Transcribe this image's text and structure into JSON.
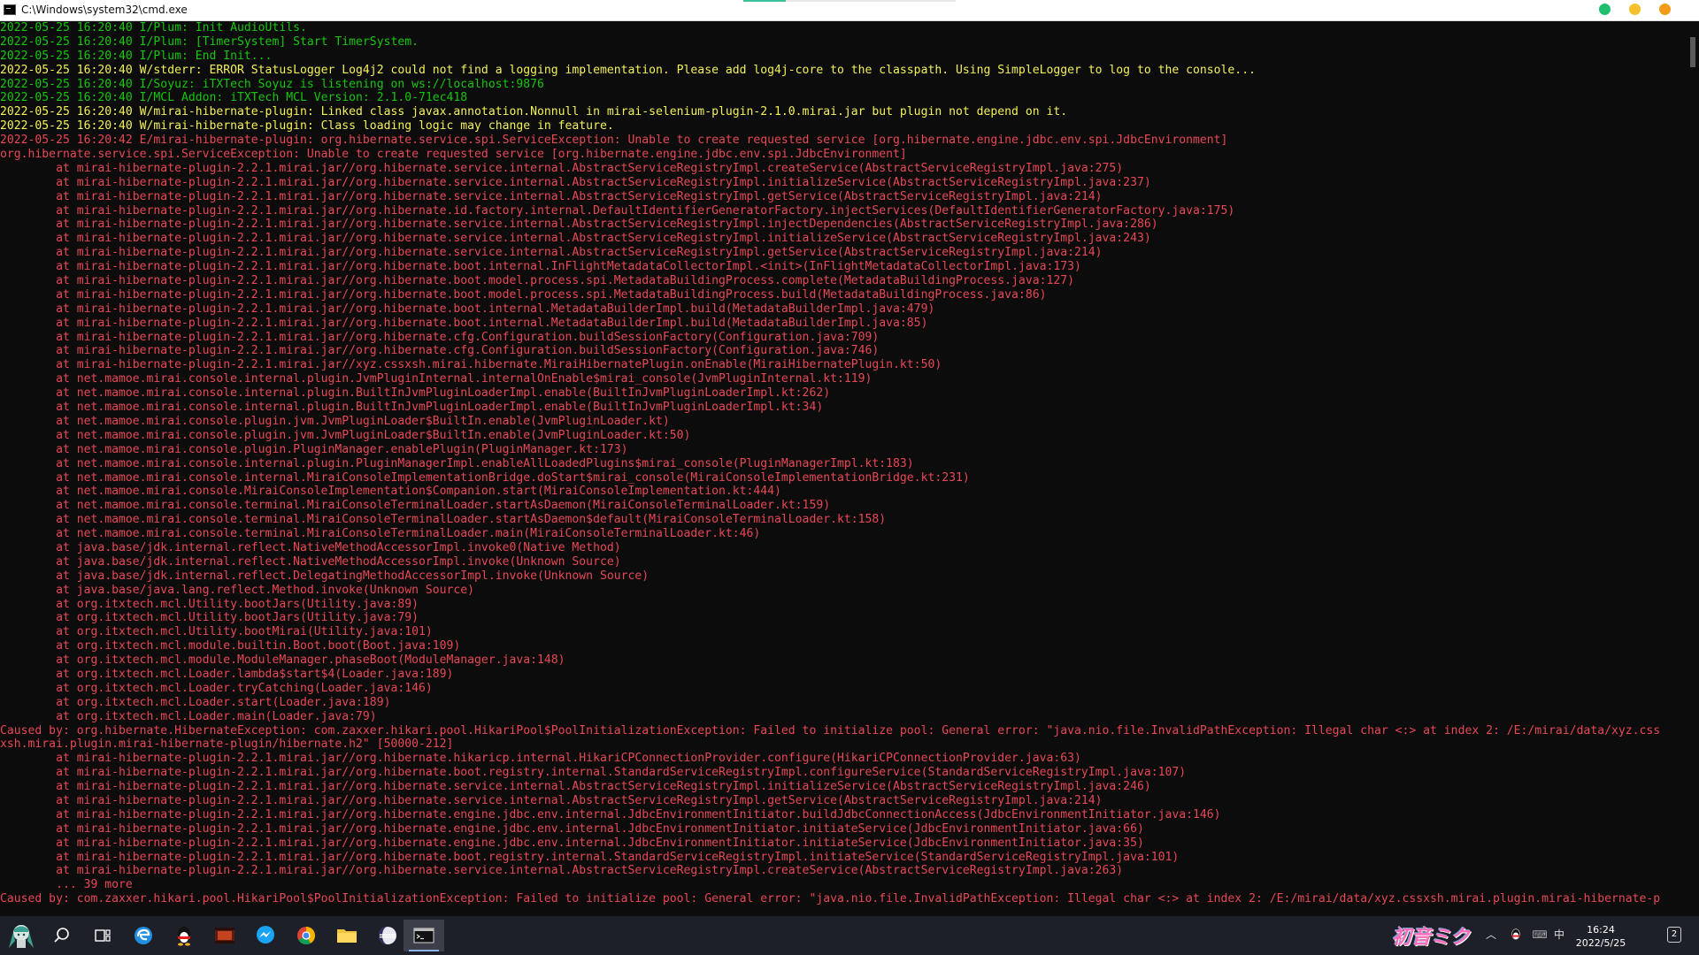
{
  "window": {
    "title": "C:\\Windows\\system32\\cmd.exe"
  },
  "colors": {
    "info": "#16c60c",
    "warn": "#f3f158",
    "error": "#e74856",
    "background": "#0c0c0c"
  },
  "console": {
    "lines": [
      {
        "c": "g",
        "t": "2022-05-25 16:20:40 I/Plum: Init AudioUtils."
      },
      {
        "c": "g",
        "t": "2022-05-25 16:20:40 I/Plum: [TimerSystem] Start TimerSystem."
      },
      {
        "c": "g",
        "t": "2022-05-25 16:20:40 I/Plum: End Init..."
      },
      {
        "c": "y",
        "t": "2022-05-25 16:20:40 W/stderr: ERROR StatusLogger Log4j2 could not find a logging implementation. Please add log4j-core to the classpath. Using SimpleLogger to log to the console..."
      },
      {
        "c": "g",
        "t": "2022-05-25 16:20:40 I/Soyuz: iTXTech Soyuz is listening on ws://localhost:9876"
      },
      {
        "c": "g",
        "t": "2022-05-25 16:20:40 I/MCL Addon: iTXTech MCL Version: 2.1.0-71ec418"
      },
      {
        "c": "y",
        "t": "2022-05-25 16:20:40 W/mirai-hibernate-plugin: Linked class javax.annotation.Nonnull in mirai-selenium-plugin-2.1.0.mirai.jar but plugin not depend on it."
      },
      {
        "c": "y",
        "t": "2022-05-25 16:20:40 W/mirai-hibernate-plugin: Class loading logic may change in feature."
      },
      {
        "c": "r",
        "t": "2022-05-25 16:20:42 E/mirai-hibernate-plugin: org.hibernate.service.spi.ServiceException: Unable to create requested service [org.hibernate.engine.jdbc.env.spi.JdbcEnvironment]"
      },
      {
        "c": "r",
        "t": "org.hibernate.service.spi.ServiceException: Unable to create requested service [org.hibernate.engine.jdbc.env.spi.JdbcEnvironment]"
      },
      {
        "c": "r",
        "t": "        at mirai-hibernate-plugin-2.2.1.mirai.jar//org.hibernate.service.internal.AbstractServiceRegistryImpl.createService(AbstractServiceRegistryImpl.java:275)"
      },
      {
        "c": "r",
        "t": "        at mirai-hibernate-plugin-2.2.1.mirai.jar//org.hibernate.service.internal.AbstractServiceRegistryImpl.initializeService(AbstractServiceRegistryImpl.java:237)"
      },
      {
        "c": "r",
        "t": "        at mirai-hibernate-plugin-2.2.1.mirai.jar//org.hibernate.service.internal.AbstractServiceRegistryImpl.getService(AbstractServiceRegistryImpl.java:214)"
      },
      {
        "c": "r",
        "t": "        at mirai-hibernate-plugin-2.2.1.mirai.jar//org.hibernate.id.factory.internal.DefaultIdentifierGeneratorFactory.injectServices(DefaultIdentifierGeneratorFactory.java:175)"
      },
      {
        "c": "r",
        "t": "        at mirai-hibernate-plugin-2.2.1.mirai.jar//org.hibernate.service.internal.AbstractServiceRegistryImpl.injectDependencies(AbstractServiceRegistryImpl.java:286)"
      },
      {
        "c": "r",
        "t": "        at mirai-hibernate-plugin-2.2.1.mirai.jar//org.hibernate.service.internal.AbstractServiceRegistryImpl.initializeService(AbstractServiceRegistryImpl.java:243)"
      },
      {
        "c": "r",
        "t": "        at mirai-hibernate-plugin-2.2.1.mirai.jar//org.hibernate.service.internal.AbstractServiceRegistryImpl.getService(AbstractServiceRegistryImpl.java:214)"
      },
      {
        "c": "r",
        "t": "        at mirai-hibernate-plugin-2.2.1.mirai.jar//org.hibernate.boot.internal.InFlightMetadataCollectorImpl.<init>(InFlightMetadataCollectorImpl.java:173)"
      },
      {
        "c": "r",
        "t": "        at mirai-hibernate-plugin-2.2.1.mirai.jar//org.hibernate.boot.model.process.spi.MetadataBuildingProcess.complete(MetadataBuildingProcess.java:127)"
      },
      {
        "c": "r",
        "t": "        at mirai-hibernate-plugin-2.2.1.mirai.jar//org.hibernate.boot.model.process.spi.MetadataBuildingProcess.build(MetadataBuildingProcess.java:86)"
      },
      {
        "c": "r",
        "t": "        at mirai-hibernate-plugin-2.2.1.mirai.jar//org.hibernate.boot.internal.MetadataBuilderImpl.build(MetadataBuilderImpl.java:479)"
      },
      {
        "c": "r",
        "t": "        at mirai-hibernate-plugin-2.2.1.mirai.jar//org.hibernate.boot.internal.MetadataBuilderImpl.build(MetadataBuilderImpl.java:85)"
      },
      {
        "c": "r",
        "t": "        at mirai-hibernate-plugin-2.2.1.mirai.jar//org.hibernate.cfg.Configuration.buildSessionFactory(Configuration.java:709)"
      },
      {
        "c": "r",
        "t": "        at mirai-hibernate-plugin-2.2.1.mirai.jar//org.hibernate.cfg.Configuration.buildSessionFactory(Configuration.java:746)"
      },
      {
        "c": "r",
        "t": "        at mirai-hibernate-plugin-2.2.1.mirai.jar//xyz.cssxsh.mirai.hibernate.MiraiHibernatePlugin.onEnable(MiraiHibernatePlugin.kt:50)"
      },
      {
        "c": "r",
        "t": "        at net.mamoe.mirai.console.internal.plugin.JvmPluginInternal.internalOnEnable$mirai_console(JvmPluginInternal.kt:119)"
      },
      {
        "c": "r",
        "t": "        at net.mamoe.mirai.console.internal.plugin.BuiltInJvmPluginLoaderImpl.enable(BuiltInJvmPluginLoaderImpl.kt:262)"
      },
      {
        "c": "r",
        "t": "        at net.mamoe.mirai.console.internal.plugin.BuiltInJvmPluginLoaderImpl.enable(BuiltInJvmPluginLoaderImpl.kt:34)"
      },
      {
        "c": "r",
        "t": "        at net.mamoe.mirai.console.plugin.jvm.JvmPluginLoader$BuiltIn.enable(JvmPluginLoader.kt)"
      },
      {
        "c": "r",
        "t": "        at net.mamoe.mirai.console.plugin.jvm.JvmPluginLoader$BuiltIn.enable(JvmPluginLoader.kt:50)"
      },
      {
        "c": "r",
        "t": "        at net.mamoe.mirai.console.plugin.PluginManager.enablePlugin(PluginManager.kt:173)"
      },
      {
        "c": "r",
        "t": "        at net.mamoe.mirai.console.internal.plugin.PluginManagerImpl.enableAllLoadedPlugins$mirai_console(PluginManagerImpl.kt:183)"
      },
      {
        "c": "r",
        "t": "        at net.mamoe.mirai.console.internal.MiraiConsoleImplementationBridge.doStart$mirai_console(MiraiConsoleImplementationBridge.kt:231)"
      },
      {
        "c": "r",
        "t": "        at net.mamoe.mirai.console.MiraiConsoleImplementation$Companion.start(MiraiConsoleImplementation.kt:444)"
      },
      {
        "c": "r",
        "t": "        at net.mamoe.mirai.console.terminal.MiraiConsoleTerminalLoader.startAsDaemon(MiraiConsoleTerminalLoader.kt:159)"
      },
      {
        "c": "r",
        "t": "        at net.mamoe.mirai.console.terminal.MiraiConsoleTerminalLoader.startAsDaemon$default(MiraiConsoleTerminalLoader.kt:158)"
      },
      {
        "c": "r",
        "t": "        at net.mamoe.mirai.console.terminal.MiraiConsoleTerminalLoader.main(MiraiConsoleTerminalLoader.kt:46)"
      },
      {
        "c": "r",
        "t": "        at java.base/jdk.internal.reflect.NativeMethodAccessorImpl.invoke0(Native Method)"
      },
      {
        "c": "r",
        "t": "        at java.base/jdk.internal.reflect.NativeMethodAccessorImpl.invoke(Unknown Source)"
      },
      {
        "c": "r",
        "t": "        at java.base/jdk.internal.reflect.DelegatingMethodAccessorImpl.invoke(Unknown Source)"
      },
      {
        "c": "r",
        "t": "        at java.base/java.lang.reflect.Method.invoke(Unknown Source)"
      },
      {
        "c": "r",
        "t": "        at org.itxtech.mcl.Utility.bootJars(Utility.java:89)"
      },
      {
        "c": "r",
        "t": "        at org.itxtech.mcl.Utility.bootJars(Utility.java:79)"
      },
      {
        "c": "r",
        "t": "        at org.itxtech.mcl.Utility.bootMirai(Utility.java:101)"
      },
      {
        "c": "r",
        "t": "        at org.itxtech.mcl.module.builtin.Boot.boot(Boot.java:109)"
      },
      {
        "c": "r",
        "t": "        at org.itxtech.mcl.module.ModuleManager.phaseBoot(ModuleManager.java:148)"
      },
      {
        "c": "r",
        "t": "        at org.itxtech.mcl.Loader.lambda$start$4(Loader.java:189)"
      },
      {
        "c": "r",
        "t": "        at org.itxtech.mcl.Loader.tryCatching(Loader.java:146)"
      },
      {
        "c": "r",
        "t": "        at org.itxtech.mcl.Loader.start(Loader.java:189)"
      },
      {
        "c": "r",
        "t": "        at org.itxtech.mcl.Loader.main(Loader.java:79)"
      },
      {
        "c": "r",
        "t": "Caused by: org.hibernate.HibernateException: com.zaxxer.hikari.pool.HikariPool$PoolInitializationException: Failed to initialize pool: General error: \"java.nio.file.InvalidPathException: Illegal char <:> at index 2: /E:/mirai/data/xyz.css"
      },
      {
        "c": "r",
        "t": "xsh.mirai.plugin.mirai-hibernate-plugin/hibernate.h2\" [50000-212]"
      },
      {
        "c": "r",
        "t": "        at mirai-hibernate-plugin-2.2.1.mirai.jar//org.hibernate.hikaricp.internal.HikariCPConnectionProvider.configure(HikariCPConnectionProvider.java:63)"
      },
      {
        "c": "r",
        "t": "        at mirai-hibernate-plugin-2.2.1.mirai.jar//org.hibernate.boot.registry.internal.StandardServiceRegistryImpl.configureService(StandardServiceRegistryImpl.java:107)"
      },
      {
        "c": "r",
        "t": "        at mirai-hibernate-plugin-2.2.1.mirai.jar//org.hibernate.service.internal.AbstractServiceRegistryImpl.initializeService(AbstractServiceRegistryImpl.java:246)"
      },
      {
        "c": "r",
        "t": "        at mirai-hibernate-plugin-2.2.1.mirai.jar//org.hibernate.service.internal.AbstractServiceRegistryImpl.getService(AbstractServiceRegistryImpl.java:214)"
      },
      {
        "c": "r",
        "t": "        at mirai-hibernate-plugin-2.2.1.mirai.jar//org.hibernate.engine.jdbc.env.internal.JdbcEnvironmentInitiator.buildJdbcConnectionAccess(JdbcEnvironmentInitiator.java:146)"
      },
      {
        "c": "r",
        "t": "        at mirai-hibernate-plugin-2.2.1.mirai.jar//org.hibernate.engine.jdbc.env.internal.JdbcEnvironmentInitiator.initiateService(JdbcEnvironmentInitiator.java:66)"
      },
      {
        "c": "r",
        "t": "        at mirai-hibernate-plugin-2.2.1.mirai.jar//org.hibernate.engine.jdbc.env.internal.JdbcEnvironmentInitiator.initiateService(JdbcEnvironmentInitiator.java:35)"
      },
      {
        "c": "r",
        "t": "        at mirai-hibernate-plugin-2.2.1.mirai.jar//org.hibernate.boot.registry.internal.StandardServiceRegistryImpl.initiateService(StandardServiceRegistryImpl.java:101)"
      },
      {
        "c": "r",
        "t": "        at mirai-hibernate-plugin-2.2.1.mirai.jar//org.hibernate.service.internal.AbstractServiceRegistryImpl.createService(AbstractServiceRegistryImpl.java:263)"
      },
      {
        "c": "r",
        "t": "        ... 39 more"
      },
      {
        "c": "r",
        "t": "Caused by: com.zaxxer.hikari.pool.HikariPool$PoolInitializationException: Failed to initialize pool: General error: \"java.nio.file.InvalidPathException: Illegal char <:> at index 2: /E:/mirai/data/xyz.cssxsh.mirai.plugin.mirai-hibernate-p"
      }
    ]
  },
  "taskbar": {
    "apps": [
      {
        "name": "start-button",
        "icon": "mascot-icon"
      },
      {
        "name": "search-button",
        "icon": "search-icon"
      },
      {
        "name": "task-view-button",
        "icon": "task-view-icon"
      },
      {
        "name": "edge-app",
        "icon": "edge-icon"
      },
      {
        "name": "qq-app",
        "icon": "penguin-icon"
      },
      {
        "name": "media-app",
        "icon": "film-icon"
      },
      {
        "name": "messenger-app",
        "icon": "messenger-icon"
      },
      {
        "name": "chrome-app",
        "icon": "chrome-icon"
      },
      {
        "name": "file-explorer-app",
        "icon": "folder-icon"
      },
      {
        "name": "eclipse-app",
        "icon": "eclipse-icon"
      },
      {
        "name": "cmd-app",
        "icon": "terminal-icon"
      }
    ],
    "brand_text": "初音ミク",
    "ime_label": "中",
    "clock_time": "16:24",
    "clock_date": "2022/5/25",
    "notification_count": "2"
  }
}
